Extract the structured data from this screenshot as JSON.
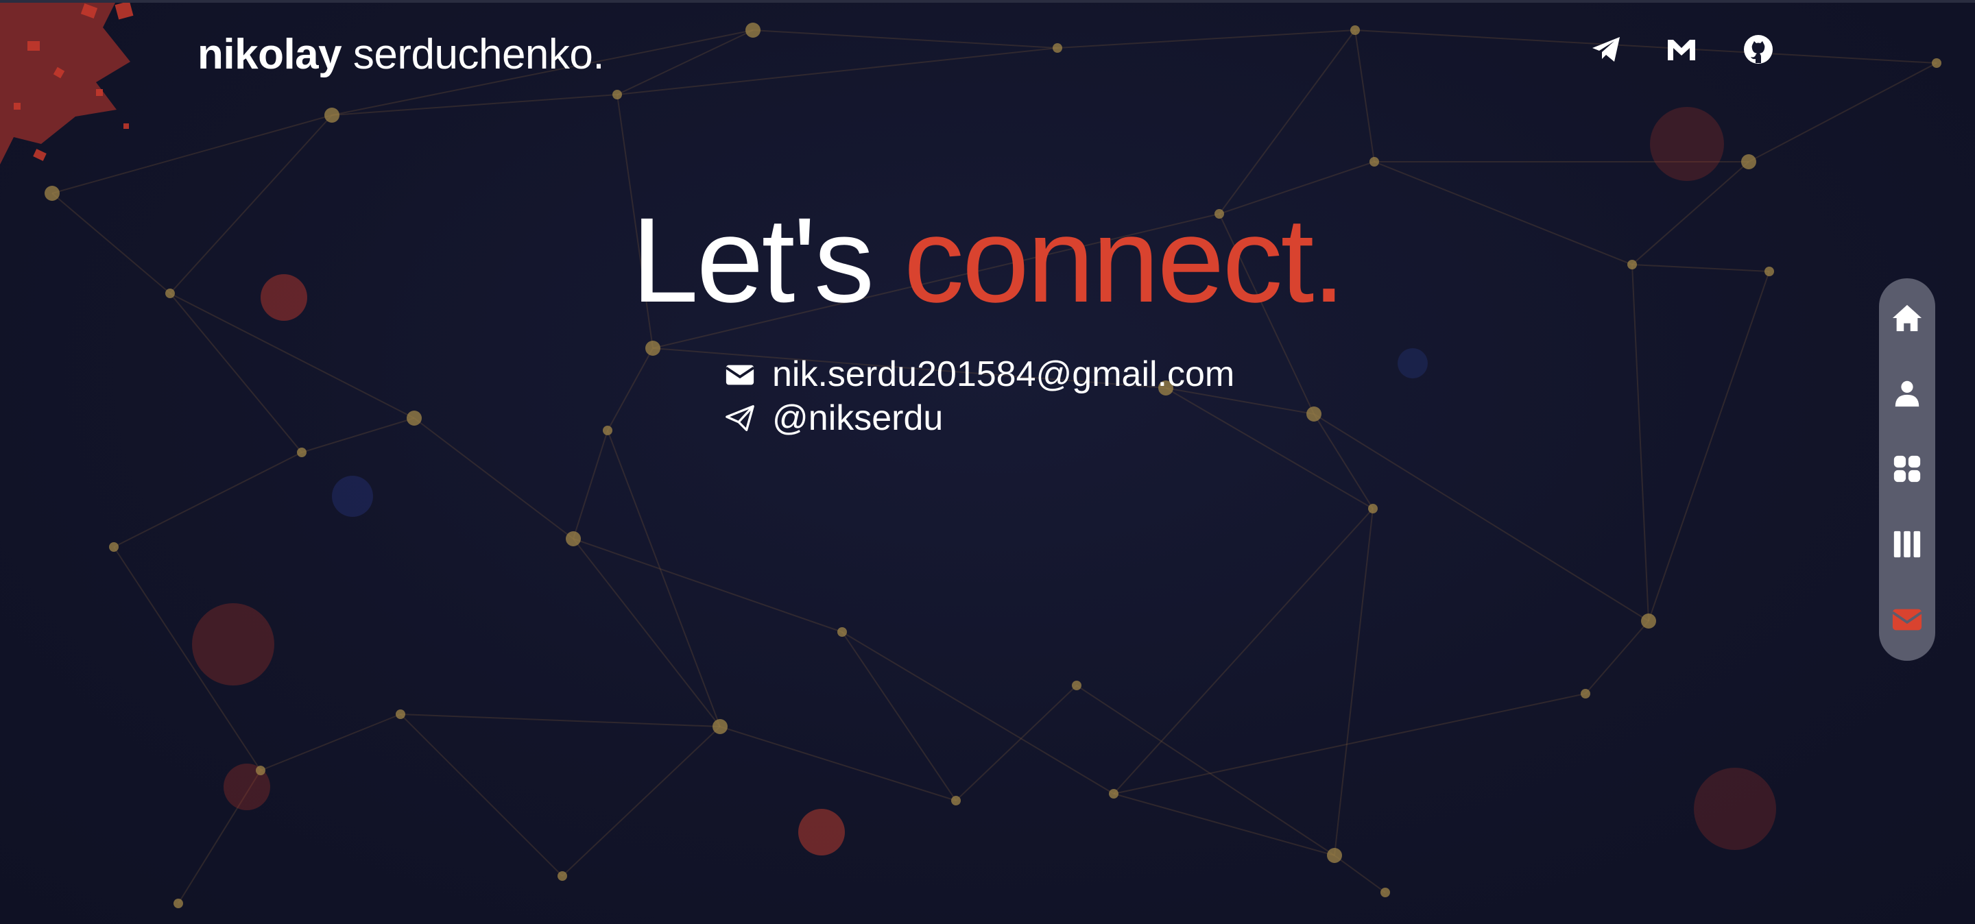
{
  "header": {
    "logo_bold": "nikolay",
    "logo_light": "serduchenko."
  },
  "social": [
    {
      "name": "telegram",
      "icon": "telegram-icon"
    },
    {
      "name": "gmail",
      "icon": "gmail-icon"
    },
    {
      "name": "github",
      "icon": "github-icon"
    }
  ],
  "hero": {
    "title_start": "Let's",
    "title_accent": "connect."
  },
  "contacts": {
    "email": "nik.serdu201584@gmail.com",
    "telegram": "@nikserdu"
  },
  "side_nav": [
    {
      "name": "home",
      "icon": "home-icon",
      "active": false
    },
    {
      "name": "about",
      "icon": "user-icon",
      "active": false
    },
    {
      "name": "portfolio",
      "icon": "grid-icon",
      "active": false
    },
    {
      "name": "experience",
      "icon": "columns-icon",
      "active": false
    },
    {
      "name": "contact",
      "icon": "envelope-icon",
      "active": true
    }
  ],
  "colors": {
    "background": "#13152b",
    "accent": "#d9432f",
    "text": "#ffffff",
    "nav_bg": "#5a5c6d"
  }
}
